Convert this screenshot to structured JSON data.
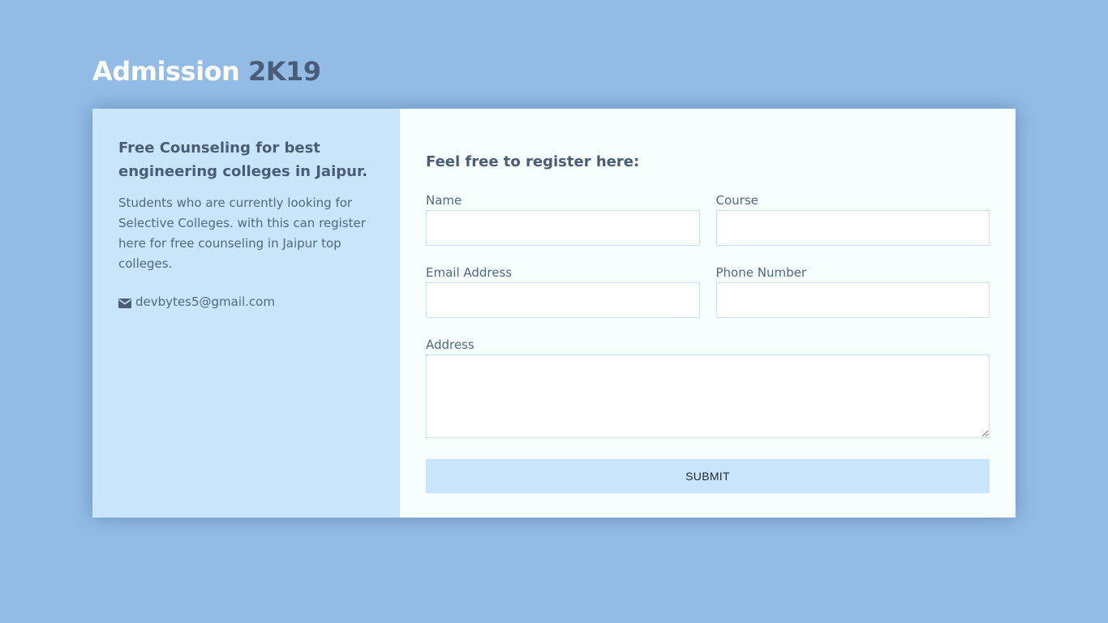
{
  "header": {
    "title_main": "Admission",
    "title_accent": "2K19"
  },
  "info": {
    "heading": "Free Counseling for best engineering colleges in Jaipur.",
    "description": "Students who are currently looking for Selective Colleges. with this can register here for free counseling in Jaipur top colleges.",
    "email": "devbytes5@gmail.com",
    "email_icon": "envelope-icon"
  },
  "form": {
    "heading": "Feel free to register here:",
    "name_label": "Name",
    "name_value": "",
    "course_label": "Course",
    "course_value": "",
    "email_label": "Email Address",
    "email_value": "",
    "phone_label": "Phone Number",
    "phone_value": "",
    "address_label": "Address",
    "address_value": "",
    "submit_label": "SUBMIT"
  },
  "colors": {
    "background": "#92bce6",
    "panel_light": "#c8e5fc",
    "card": "#f7fffe",
    "text_dark": "#4a5d78"
  }
}
